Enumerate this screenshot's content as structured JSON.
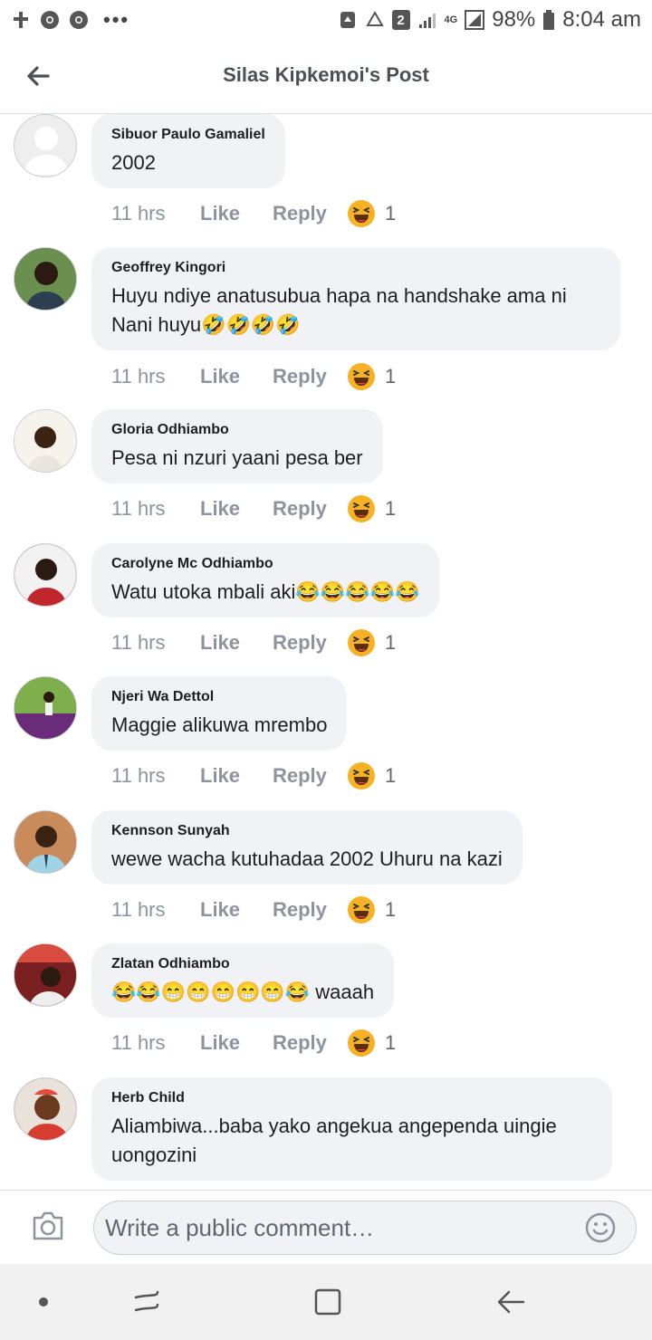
{
  "status_bar": {
    "battery": "98%",
    "time": "8:04 am",
    "sim_badge": "2",
    "network": "4G",
    "icons": [
      "tools-icon",
      "chrome-icon",
      "chrome-icon",
      "more-dots-icon",
      "recycle-icon",
      "recycle-outline-icon",
      "signal-icon",
      "signal-icon",
      "battery-icon"
    ]
  },
  "header": {
    "title": "Silas Kipkemoi's Post"
  },
  "actions": {
    "like": "Like",
    "reply": "Reply"
  },
  "comments": [
    {
      "name": "Sibuor Paulo Gamaliel",
      "text": "2002",
      "time": "11 hrs",
      "reactions": "1"
    },
    {
      "name": "Geoffrey Kingori",
      "text": "Huyu ndiye anatusubua hapa na handshake ama ni Nani huyu🤣🤣🤣🤣",
      "time": "11 hrs",
      "reactions": "1"
    },
    {
      "name": "Gloria Odhiambo",
      "text": "Pesa ni nzuri yaani pesa ber",
      "time": "11 hrs",
      "reactions": "1"
    },
    {
      "name": "Carolyne Mc Odhiambo",
      "text": "Watu utoka mbali aki😂😂😂😂😂",
      "time": "11 hrs",
      "reactions": "1"
    },
    {
      "name": "Njeri Wa Dettol",
      "text": "Maggie alikuwa mrembo",
      "time": "11 hrs",
      "reactions": "1"
    },
    {
      "name": "Kennson Sunyah",
      "text": "wewe wacha kutuhadaa 2002  Uhuru na kazi",
      "time": "11 hrs",
      "reactions": "1"
    },
    {
      "name": "Zlatan Odhiambo",
      "text": "😂😂😁😁😁😁😁😂 waaah",
      "time": "11 hrs",
      "reactions": "1"
    },
    {
      "name": "Herb Child",
      "text": "Aliambiwa...baba yako angekua angependa uingie uongozini"
    }
  ],
  "composer": {
    "placeholder": "Write a public comment…"
  },
  "colors": {
    "bubble": "#f0f2f5",
    "meta_text": "#8d949e",
    "reaction_yellow": "#f7b125"
  }
}
